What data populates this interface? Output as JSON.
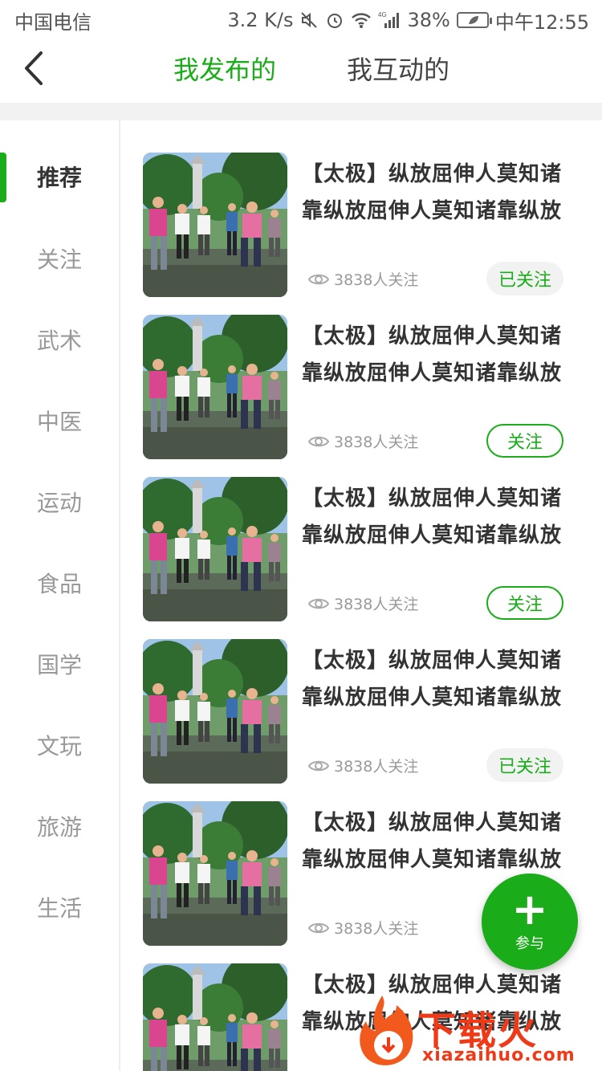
{
  "status_bar": {
    "carrier": "中国电信",
    "speed": "3.2 K/s",
    "network": "4G",
    "battery": "38%",
    "time": "中午12:55"
  },
  "header": {
    "tabs": [
      {
        "label": "我发布的",
        "active": true
      },
      {
        "label": "我互动的",
        "active": false
      }
    ]
  },
  "sidebar": {
    "items": [
      {
        "label": "推荐",
        "active": true
      },
      {
        "label": "关注"
      },
      {
        "label": "武术"
      },
      {
        "label": "中医"
      },
      {
        "label": "运动"
      },
      {
        "label": "食品"
      },
      {
        "label": "国学"
      },
      {
        "label": "文玩"
      },
      {
        "label": "旅游"
      },
      {
        "label": "生活"
      }
    ]
  },
  "list": {
    "items": [
      {
        "title": "【太极】纵放屈伸人莫知诸靠纵放屈伸人莫知诸靠纵放",
        "followers": "3838人关注",
        "button": "已关注",
        "state": "followed"
      },
      {
        "title": "【太极】纵放屈伸人莫知诸靠纵放屈伸人莫知诸靠纵放",
        "followers": "3838人关注",
        "button": "关注",
        "state": "follow"
      },
      {
        "title": "【太极】纵放屈伸人莫知诸靠纵放屈伸人莫知诸靠纵放",
        "followers": "3838人关注",
        "button": "关注",
        "state": "follow"
      },
      {
        "title": "【太极】纵放屈伸人莫知诸靠纵放屈伸人莫知诸靠纵放",
        "followers": "3838人关注",
        "button": "已关注",
        "state": "followed"
      },
      {
        "title": "【太极】纵放屈伸人莫知诸靠纵放屈伸人莫知诸靠纵放",
        "followers": "3838人关注",
        "button": "",
        "state": "hidden"
      },
      {
        "title": "【太极】纵放屈伸人莫知诸靠纵放屈伸人莫知诸靠纵放",
        "followers": "",
        "button": "",
        "state": "hidden"
      }
    ]
  },
  "fab": {
    "plus": "+",
    "label": "参与"
  },
  "watermark": {
    "text": "下载火",
    "sub": "xiazaihuo.com"
  },
  "colors": {
    "accent": "#1aad19",
    "watermark": "#f03a17"
  }
}
